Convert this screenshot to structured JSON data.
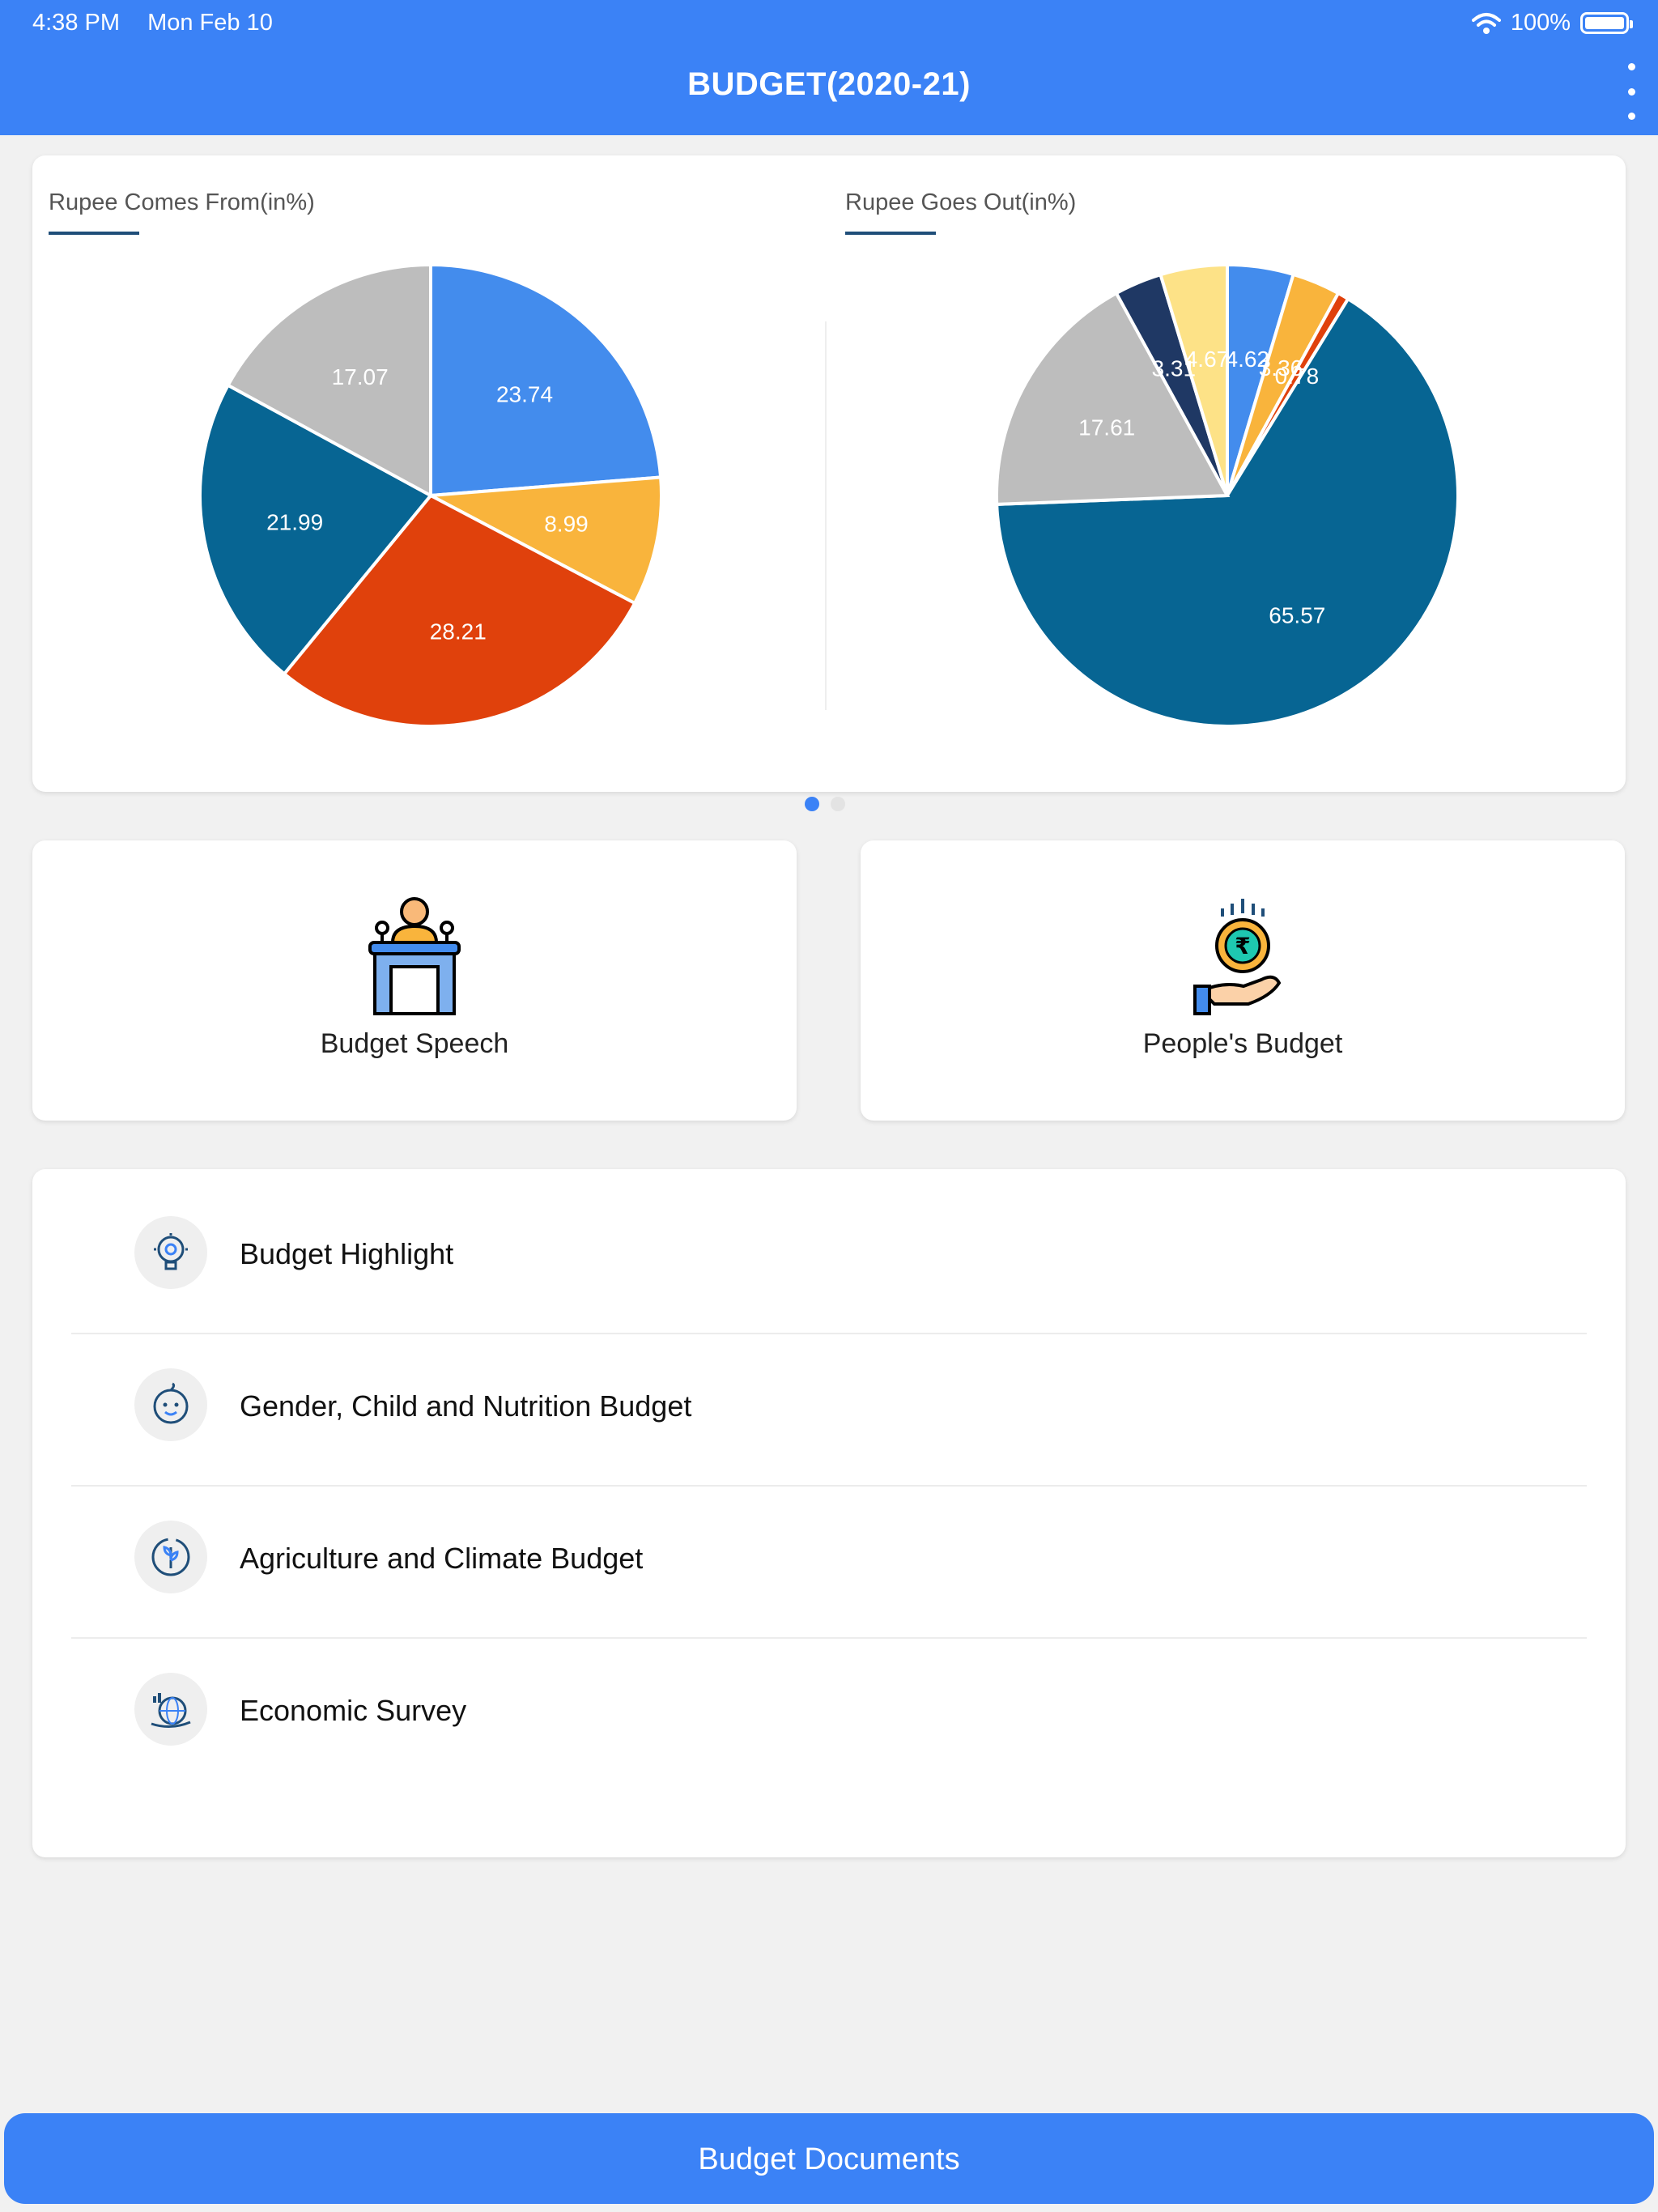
{
  "status_bar": {
    "time": "4:38 PM",
    "date": "Mon Feb 10",
    "battery": "100%"
  },
  "header": {
    "title": "BUDGET(2020-21)"
  },
  "charts": {
    "left_title": "Rupee Comes From(in%)",
    "right_title": "Rupee Goes Out(in%)"
  },
  "chart_data": [
    {
      "type": "pie",
      "title": "Rupee Comes From(in%)",
      "slices": [
        {
          "label": "23.74",
          "value": 23.74,
          "color": "#438ced"
        },
        {
          "label": "8.99",
          "value": 8.99,
          "color": "#f9b43c"
        },
        {
          "label": "28.21",
          "value": 28.21,
          "color": "#e0410c"
        },
        {
          "label": "21.99",
          "value": 21.99,
          "color": "#076593"
        },
        {
          "label": "17.07",
          "value": 17.07,
          "color": "#bdbdbd"
        }
      ]
    },
    {
      "type": "pie",
      "title": "Rupee Goes Out(in%)",
      "slices": [
        {
          "label": "4.62",
          "value": 4.62,
          "color": "#438ced"
        },
        {
          "label": "3.36",
          "value": 3.36,
          "color": "#f9b43c"
        },
        {
          "label": "0.78",
          "value": 0.78,
          "color": "#e0410c"
        },
        {
          "label": "65.57",
          "value": 65.57,
          "color": "#076593"
        },
        {
          "label": "17.61",
          "value": 17.61,
          "color": "#bdbdbd"
        },
        {
          "label": "3.31",
          "value": 3.31,
          "color": "#1f3864"
        },
        {
          "label": "4.67",
          "value": 4.67,
          "color": "#fde287"
        }
      ]
    }
  ],
  "tiles": [
    {
      "label": "Budget Speech",
      "icon": "podium-speaker-icon"
    },
    {
      "label": "People's Budget",
      "icon": "rupee-coin-hand-icon"
    }
  ],
  "links": [
    {
      "label": "Budget Highlight",
      "icon": "lightbulb-gear-icon"
    },
    {
      "label": "Gender, Child and Nutrition Budget",
      "icon": "baby-face-icon"
    },
    {
      "label": "Agriculture and Climate Budget",
      "icon": "plant-circle-icon"
    },
    {
      "label": "Economic Survey",
      "icon": "globe-chart-icon"
    }
  ],
  "footer": {
    "button_label": "Budget Documents"
  },
  "colors": {
    "primary": "#3b82f6",
    "underline": "#1f4e79"
  }
}
